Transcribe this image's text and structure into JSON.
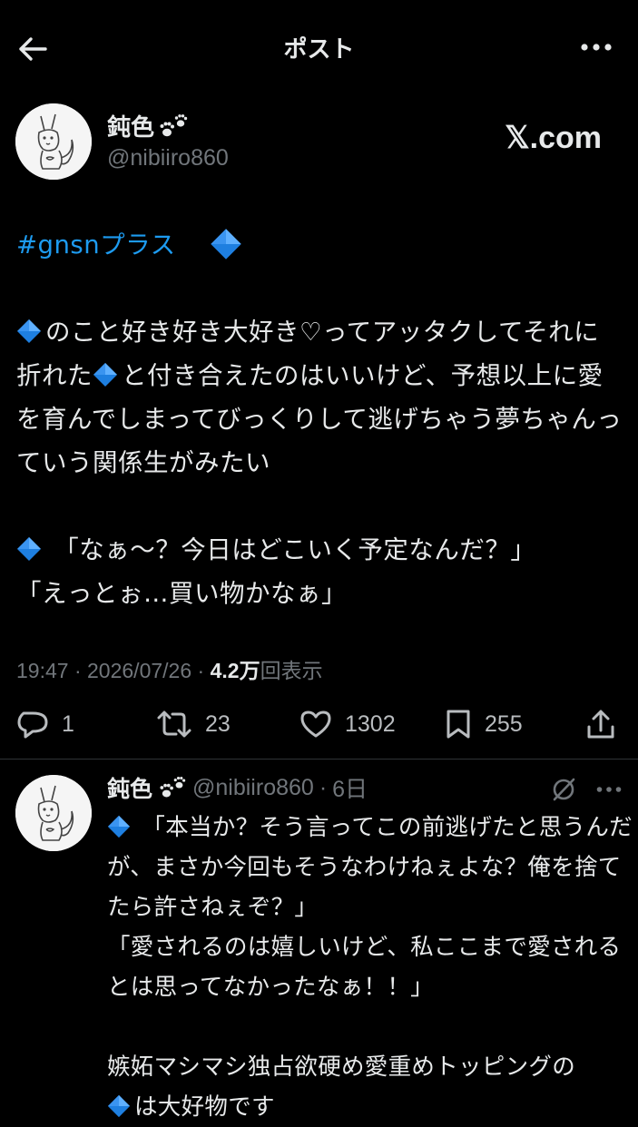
{
  "header": {
    "title": "ポスト"
  },
  "post": {
    "display_name": "鈍色",
    "handle": "@nibiiro860",
    "badge": "𝕏.com",
    "hashtag": "#gnsnプラス",
    "line1_text": "のこと好き好き大好き♡ってアッタクしてそれに折れた",
    "line1_text2": "と付き合えたのはいいけど、予想以上に愛を育んでしまってびっくりして逃げちゃう夢ちゃんっていう関係生がみたい",
    "quote1": " 「なぁ〜？今日はどこいく予定なんだ？」",
    "quote2": "「えっとぉ…買い物かなぁ」",
    "time": "19:47",
    "date": "2026/07/26",
    "views_count": "4.2万",
    "views_label": "回表示",
    "sep": " · "
  },
  "actions": {
    "replies": "1",
    "reposts": "23",
    "likes": "1302",
    "bookmarks": "255"
  },
  "reply": {
    "display_name": "鈍色",
    "handle": "@nibiiro860",
    "age": "6日",
    "sep": "·",
    "line1": " 「本当か？そう言ってこの前逃げたと思うんだが、まさか今回もそうなわけねぇよな？俺を捨てたら許さねぇぞ？」",
    "line2": "「愛されるのは嬉しいけど、私ここまで愛されるとは思ってなかったなぁ！！」",
    "line3": "嫉妬マシマシ独占欲硬め愛重めトッピングの",
    "line4": "は大好物です"
  },
  "icons": {
    "back": "arrow-left-icon",
    "more": "more-horizontal-icon",
    "reply": "speech-bubble-icon",
    "repost": "repost-icon",
    "like": "heart-icon",
    "bookmark": "bookmark-icon",
    "share": "share-icon",
    "gem": "blue-diamond-emoji",
    "paw": "paw-prints-emoji",
    "grok": "slashed-circle-icon"
  },
  "colors": {
    "background": "#000000",
    "text": "#e7e9ea",
    "secondary": "#71767b",
    "link": "#1d9bf0",
    "gem": "#1e7fe0"
  }
}
